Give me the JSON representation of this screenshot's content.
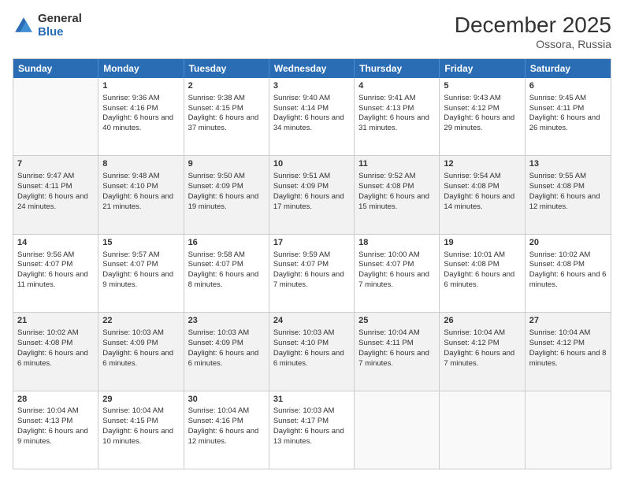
{
  "logo": {
    "general": "General",
    "blue": "Blue"
  },
  "title": "December 2025",
  "subtitle": "Ossora, Russia",
  "days": [
    "Sunday",
    "Monday",
    "Tuesday",
    "Wednesday",
    "Thursday",
    "Friday",
    "Saturday"
  ],
  "rows": [
    [
      {
        "day": "",
        "empty": true
      },
      {
        "day": "1",
        "sunrise": "Sunrise: 9:36 AM",
        "sunset": "Sunset: 4:16 PM",
        "daylight": "Daylight: 6 hours and 40 minutes."
      },
      {
        "day": "2",
        "sunrise": "Sunrise: 9:38 AM",
        "sunset": "Sunset: 4:15 PM",
        "daylight": "Daylight: 6 hours and 37 minutes."
      },
      {
        "day": "3",
        "sunrise": "Sunrise: 9:40 AM",
        "sunset": "Sunset: 4:14 PM",
        "daylight": "Daylight: 6 hours and 34 minutes."
      },
      {
        "day": "4",
        "sunrise": "Sunrise: 9:41 AM",
        "sunset": "Sunset: 4:13 PM",
        "daylight": "Daylight: 6 hours and 31 minutes."
      },
      {
        "day": "5",
        "sunrise": "Sunrise: 9:43 AM",
        "sunset": "Sunset: 4:12 PM",
        "daylight": "Daylight: 6 hours and 29 minutes."
      },
      {
        "day": "6",
        "sunrise": "Sunrise: 9:45 AM",
        "sunset": "Sunset: 4:11 PM",
        "daylight": "Daylight: 6 hours and 26 minutes."
      }
    ],
    [
      {
        "day": "7",
        "sunrise": "Sunrise: 9:47 AM",
        "sunset": "Sunset: 4:11 PM",
        "daylight": "Daylight: 6 hours and 24 minutes."
      },
      {
        "day": "8",
        "sunrise": "Sunrise: 9:48 AM",
        "sunset": "Sunset: 4:10 PM",
        "daylight": "Daylight: 6 hours and 21 minutes."
      },
      {
        "day": "9",
        "sunrise": "Sunrise: 9:50 AM",
        "sunset": "Sunset: 4:09 PM",
        "daylight": "Daylight: 6 hours and 19 minutes."
      },
      {
        "day": "10",
        "sunrise": "Sunrise: 9:51 AM",
        "sunset": "Sunset: 4:09 PM",
        "daylight": "Daylight: 6 hours and 17 minutes."
      },
      {
        "day": "11",
        "sunrise": "Sunrise: 9:52 AM",
        "sunset": "Sunset: 4:08 PM",
        "daylight": "Daylight: 6 hours and 15 minutes."
      },
      {
        "day": "12",
        "sunrise": "Sunrise: 9:54 AM",
        "sunset": "Sunset: 4:08 PM",
        "daylight": "Daylight: 6 hours and 14 minutes."
      },
      {
        "day": "13",
        "sunrise": "Sunrise: 9:55 AM",
        "sunset": "Sunset: 4:08 PM",
        "daylight": "Daylight: 6 hours and 12 minutes."
      }
    ],
    [
      {
        "day": "14",
        "sunrise": "Sunrise: 9:56 AM",
        "sunset": "Sunset: 4:07 PM",
        "daylight": "Daylight: 6 hours and 11 minutes."
      },
      {
        "day": "15",
        "sunrise": "Sunrise: 9:57 AM",
        "sunset": "Sunset: 4:07 PM",
        "daylight": "Daylight: 6 hours and 9 minutes."
      },
      {
        "day": "16",
        "sunrise": "Sunrise: 9:58 AM",
        "sunset": "Sunset: 4:07 PM",
        "daylight": "Daylight: 6 hours and 8 minutes."
      },
      {
        "day": "17",
        "sunrise": "Sunrise: 9:59 AM",
        "sunset": "Sunset: 4:07 PM",
        "daylight": "Daylight: 6 hours and 7 minutes."
      },
      {
        "day": "18",
        "sunrise": "Sunrise: 10:00 AM",
        "sunset": "Sunset: 4:07 PM",
        "daylight": "Daylight: 6 hours and 7 minutes."
      },
      {
        "day": "19",
        "sunrise": "Sunrise: 10:01 AM",
        "sunset": "Sunset: 4:08 PM",
        "daylight": "Daylight: 6 hours and 6 minutes."
      },
      {
        "day": "20",
        "sunrise": "Sunrise: 10:02 AM",
        "sunset": "Sunset: 4:08 PM",
        "daylight": "Daylight: 6 hours and 6 minutes."
      }
    ],
    [
      {
        "day": "21",
        "sunrise": "Sunrise: 10:02 AM",
        "sunset": "Sunset: 4:08 PM",
        "daylight": "Daylight: 6 hours and 6 minutes."
      },
      {
        "day": "22",
        "sunrise": "Sunrise: 10:03 AM",
        "sunset": "Sunset: 4:09 PM",
        "daylight": "Daylight: 6 hours and 6 minutes."
      },
      {
        "day": "23",
        "sunrise": "Sunrise: 10:03 AM",
        "sunset": "Sunset: 4:09 PM",
        "daylight": "Daylight: 6 hours and 6 minutes."
      },
      {
        "day": "24",
        "sunrise": "Sunrise: 10:03 AM",
        "sunset": "Sunset: 4:10 PM",
        "daylight": "Daylight: 6 hours and 6 minutes."
      },
      {
        "day": "25",
        "sunrise": "Sunrise: 10:04 AM",
        "sunset": "Sunset: 4:11 PM",
        "daylight": "Daylight: 6 hours and 7 minutes."
      },
      {
        "day": "26",
        "sunrise": "Sunrise: 10:04 AM",
        "sunset": "Sunset: 4:12 PM",
        "daylight": "Daylight: 6 hours and 7 minutes."
      },
      {
        "day": "27",
        "sunrise": "Sunrise: 10:04 AM",
        "sunset": "Sunset: 4:12 PM",
        "daylight": "Daylight: 6 hours and 8 minutes."
      }
    ],
    [
      {
        "day": "28",
        "sunrise": "Sunrise: 10:04 AM",
        "sunset": "Sunset: 4:13 PM",
        "daylight": "Daylight: 6 hours and 9 minutes."
      },
      {
        "day": "29",
        "sunrise": "Sunrise: 10:04 AM",
        "sunset": "Sunset: 4:15 PM",
        "daylight": "Daylight: 6 hours and 10 minutes."
      },
      {
        "day": "30",
        "sunrise": "Sunrise: 10:04 AM",
        "sunset": "Sunset: 4:16 PM",
        "daylight": "Daylight: 6 hours and 12 minutes."
      },
      {
        "day": "31",
        "sunrise": "Sunrise: 10:03 AM",
        "sunset": "Sunset: 4:17 PM",
        "daylight": "Daylight: 6 hours and 13 minutes."
      },
      {
        "day": "",
        "empty": true
      },
      {
        "day": "",
        "empty": true
      },
      {
        "day": "",
        "empty": true
      }
    ]
  ]
}
